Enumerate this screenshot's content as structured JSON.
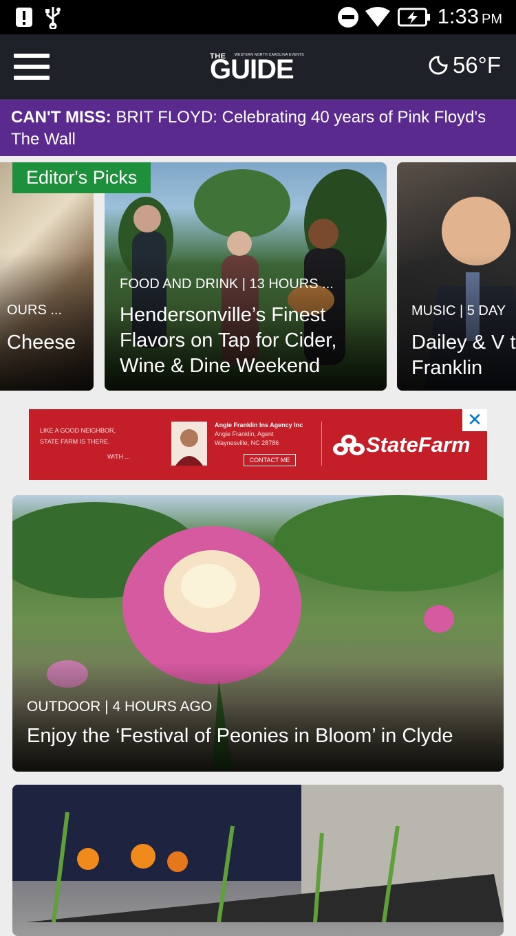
{
  "status_bar": {
    "time": "1:33",
    "ampm": "PM"
  },
  "header": {
    "logo_the": "THE",
    "logo_tagline": "WESTERN NORTH CAROLINA EVENTS",
    "logo_main": "GUIDE",
    "temperature": "56°F"
  },
  "cant_miss": {
    "label": "CAN'T MISS:",
    "text": " BRIT FLOYD: Celebrating 40 years of Pink Floyd's The Wall"
  },
  "editors_picks": {
    "badge": "Editor's Picks",
    "cards": [
      {
        "meta": "OURS ...",
        "title": "Cheese"
      },
      {
        "meta": "FOOD AND DRINK | 13 HOURS ...",
        "title": "Hendersonville’s Finest Flavors on Tap for Cider, Wine & Dine Weekend"
      },
      {
        "meta": "MUSIC | 5 DAY",
        "title": "Dailey & V to Franklin"
      }
    ]
  },
  "ad": {
    "left_text_1": "LIKE A GOOD NEIGHBOR,",
    "left_text_2": "STATE FARM IS THERE.",
    "left_text_3": "WITH ...",
    "agent_name": "Angie Franklin Ins Agency Inc",
    "agent_title": "Angie Franklin, Agent",
    "agent_city": "Waynesville, NC 28786",
    "contact": "CONTACT ME",
    "brand": "StateFarm",
    "close": "✕"
  },
  "stories": [
    {
      "meta": "OUTDOOR | 4 HOURS AGO",
      "title": "Enjoy the ‘Festival of Peonies in Bloom’ in Clyde"
    }
  ],
  "colors": {
    "brand_purple": "#5b2a8e",
    "picks_green": "#1e8f3a",
    "ad_red": "#c41f28",
    "header_bg": "#1e2128"
  }
}
